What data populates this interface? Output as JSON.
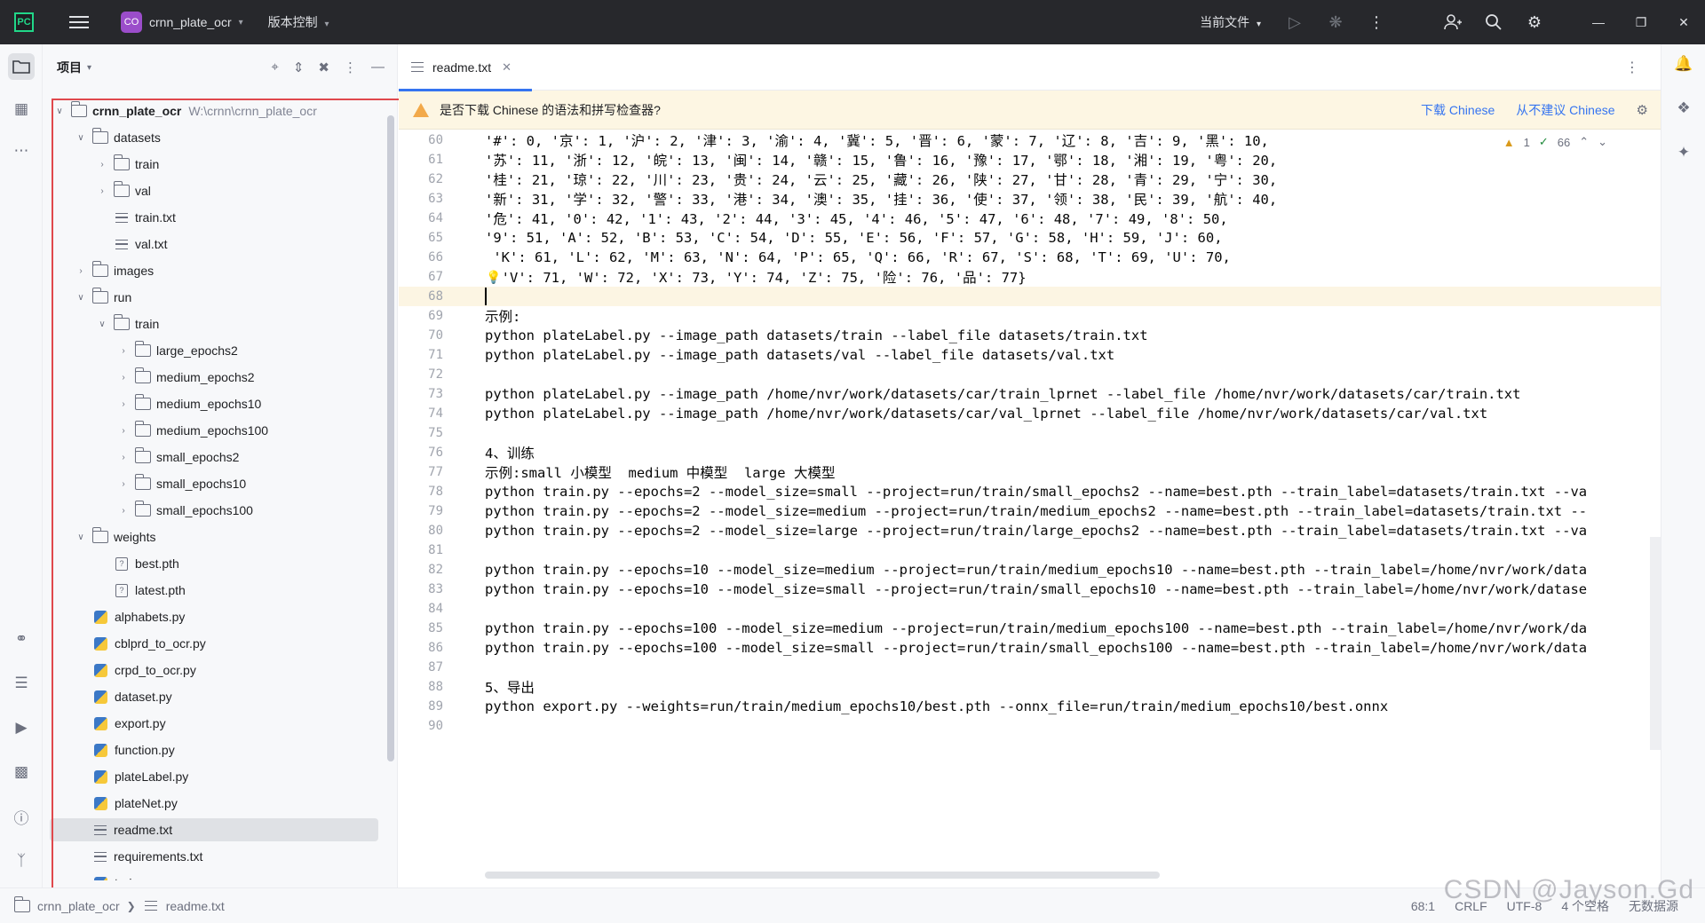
{
  "titlebar": {
    "logo": "PC",
    "project_badge": "CO",
    "project_name": "crnn_plate_ocr",
    "vcs": "版本控制",
    "run_config": "当前文件",
    "icons": [
      "run-icon",
      "debug-icon",
      "more-vert-icon",
      "add-user-icon",
      "search-icon",
      "settings-icon"
    ]
  },
  "project_panel": {
    "title": "项目",
    "root": {
      "name": "crnn_plate_ocr",
      "path": "W:\\crnn\\crnn_plate_ocr"
    },
    "items": [
      {
        "label": "datasets",
        "type": "folder",
        "depth": 1,
        "expanded": true
      },
      {
        "label": "train",
        "type": "folder",
        "depth": 2,
        "expanded": false
      },
      {
        "label": "val",
        "type": "folder",
        "depth": 2,
        "expanded": false
      },
      {
        "label": "train.txt",
        "type": "txt",
        "depth": 2
      },
      {
        "label": "val.txt",
        "type": "txt",
        "depth": 2
      },
      {
        "label": "images",
        "type": "folder",
        "depth": 1,
        "expanded": false
      },
      {
        "label": "run",
        "type": "folder",
        "depth": 1,
        "expanded": true
      },
      {
        "label": "train",
        "type": "folder",
        "depth": 2,
        "expanded": true
      },
      {
        "label": "large_epochs2",
        "type": "folder",
        "depth": 3,
        "expanded": false
      },
      {
        "label": "medium_epochs2",
        "type": "folder",
        "depth": 3,
        "expanded": false
      },
      {
        "label": "medium_epochs10",
        "type": "folder",
        "depth": 3,
        "expanded": false
      },
      {
        "label": "medium_epochs100",
        "type": "folder",
        "depth": 3,
        "expanded": false
      },
      {
        "label": "small_epochs2",
        "type": "folder",
        "depth": 3,
        "expanded": false
      },
      {
        "label": "small_epochs10",
        "type": "folder",
        "depth": 3,
        "expanded": false
      },
      {
        "label": "small_epochs100",
        "type": "folder",
        "depth": 3,
        "expanded": false
      },
      {
        "label": "weights",
        "type": "folder",
        "depth": 1,
        "expanded": true
      },
      {
        "label": "best.pth",
        "type": "pth",
        "depth": 2
      },
      {
        "label": "latest.pth",
        "type": "pth",
        "depth": 2
      },
      {
        "label": "alphabets.py",
        "type": "py",
        "depth": 1
      },
      {
        "label": "cblprd_to_ocr.py",
        "type": "py",
        "depth": 1
      },
      {
        "label": "crpd_to_ocr.py",
        "type": "py",
        "depth": 1
      },
      {
        "label": "dataset.py",
        "type": "py",
        "depth": 1
      },
      {
        "label": "export.py",
        "type": "py",
        "depth": 1
      },
      {
        "label": "function.py",
        "type": "py",
        "depth": 1
      },
      {
        "label": "plateLabel.py",
        "type": "py",
        "depth": 1
      },
      {
        "label": "plateNet.py",
        "type": "py",
        "depth": 1
      },
      {
        "label": "readme.txt",
        "type": "txt",
        "depth": 1,
        "selected": true
      },
      {
        "label": "requirements.txt",
        "type": "txt",
        "depth": 1
      },
      {
        "label": "train.py",
        "type": "py",
        "depth": 1
      }
    ]
  },
  "editor": {
    "tab": "readme.txt",
    "notification": {
      "message": "是否下载 Chinese 的语法和拼写检查器?",
      "action_download": "下载 Chinese",
      "action_never": "从不建议 Chinese"
    },
    "inspections": {
      "warnings": "1",
      "ok": "66"
    },
    "current_line": 68,
    "lines": [
      {
        "n": 60,
        "text": "'#': 0, '京': 1, '沪': 2, '津': 3, '渝': 4, '冀': 5, '晋': 6, '蒙': 7, '辽': 8, '吉': 9, '黑': 10,"
      },
      {
        "n": 61,
        "text": "'苏': 11, '浙': 12, '皖': 13, '闽': 14, '赣': 15, '鲁': 16, '豫': 17, '鄂': 18, '湘': 19, '粤': 20,"
      },
      {
        "n": 62,
        "text": "'桂': 21, '琼': 22, '川': 23, '贵': 24, '云': 25, '藏': 26, '陕': 27, '甘': 28, '青': 29, '宁': 30,"
      },
      {
        "n": 63,
        "text": "'新': 31, '学': 32, '警': 33, '港': 34, '澳': 35, '挂': 36, '使': 37, '领': 38, '民': 39, '航': 40,"
      },
      {
        "n": 64,
        "text": "'危': 41, '0': 42, '1': 43, '2': 44, '3': 45, '4': 46, '5': 47, '6': 48, '7': 49, '8': 50,"
      },
      {
        "n": 65,
        "text": "'9': 51, 'A': 52, 'B': 53, 'C': 54, 'D': 55, 'E': 56, 'F': 57, 'G': 58, 'H': 59, 'J': 60,"
      },
      {
        "n": 66,
        "text": " 'K': 61, 'L': 62, 'M': 63, 'N': 64, 'P': 65, 'Q': 66, 'R': 67, 'S': 68, 'T': 69, 'U': 70,"
      },
      {
        "n": 67,
        "text": "  'V': 71, 'W': 72, 'X': 73, 'Y': 74, 'Z': 75, '险': 76, '品': 77}"
      },
      {
        "n": 68,
        "text": ""
      },
      {
        "n": 69,
        "text": "示例:"
      },
      {
        "n": 70,
        "text": "python plateLabel.py --image_path datasets/train --label_file datasets/train.txt"
      },
      {
        "n": 71,
        "text": "python plateLabel.py --image_path datasets/val --label_file datasets/val.txt"
      },
      {
        "n": 72,
        "text": ""
      },
      {
        "n": 73,
        "text": "python plateLabel.py --image_path /home/nvr/work/datasets/car/train_lprnet --label_file /home/nvr/work/datasets/car/train.txt"
      },
      {
        "n": 74,
        "text": "python plateLabel.py --image_path /home/nvr/work/datasets/car/val_lprnet --label_file /home/nvr/work/datasets/car/val.txt"
      },
      {
        "n": 75,
        "text": ""
      },
      {
        "n": 76,
        "text": "4、训练"
      },
      {
        "n": 77,
        "text": "示例:small 小模型  medium 中模型  large 大模型"
      },
      {
        "n": 78,
        "text": "python train.py --epochs=2 --model_size=small --project=run/train/small_epochs2 --name=best.pth --train_label=datasets/train.txt --va"
      },
      {
        "n": 79,
        "text": "python train.py --epochs=2 --model_size=medium --project=run/train/medium_epochs2 --name=best.pth --train_label=datasets/train.txt --"
      },
      {
        "n": 80,
        "text": "python train.py --epochs=2 --model_size=large --project=run/train/large_epochs2 --name=best.pth --train_label=datasets/train.txt --va"
      },
      {
        "n": 81,
        "text": ""
      },
      {
        "n": 82,
        "text": "python train.py --epochs=10 --model_size=medium --project=run/train/medium_epochs10 --name=best.pth --train_label=/home/nvr/work/data"
      },
      {
        "n": 83,
        "text": "python train.py --epochs=10 --model_size=small --project=run/train/small_epochs10 --name=best.pth --train_label=/home/nvr/work/datase"
      },
      {
        "n": 84,
        "text": ""
      },
      {
        "n": 85,
        "text": "python train.py --epochs=100 --model_size=medium --project=run/train/medium_epochs100 --name=best.pth --train_label=/home/nvr/work/da"
      },
      {
        "n": 86,
        "text": "python train.py --epochs=100 --model_size=small --project=run/train/small_epochs100 --name=best.pth --train_label=/home/nvr/work/data"
      },
      {
        "n": 87,
        "text": ""
      },
      {
        "n": 88,
        "text": "5、导出"
      },
      {
        "n": 89,
        "text": "python export.py --weights=run/train/medium_epochs10/best.pth --onnx_file=run/train/medium_epochs10/best.onnx"
      },
      {
        "n": 90,
        "text": ""
      }
    ]
  },
  "statusbar": {
    "crumb_project": "crnn_plate_ocr",
    "crumb_file": "readme.txt",
    "position": "68:1",
    "line_sep": "CRLF",
    "encoding": "UTF-8",
    "indent": "4 个空格",
    "readonly": "无数据源"
  },
  "watermark": "CSDN @Jayson.Gd",
  "colors": {
    "accent": "#3574f0",
    "highlight_box": "#e0484c",
    "titlebar": "#27282c",
    "warning": "#f2a94a"
  }
}
